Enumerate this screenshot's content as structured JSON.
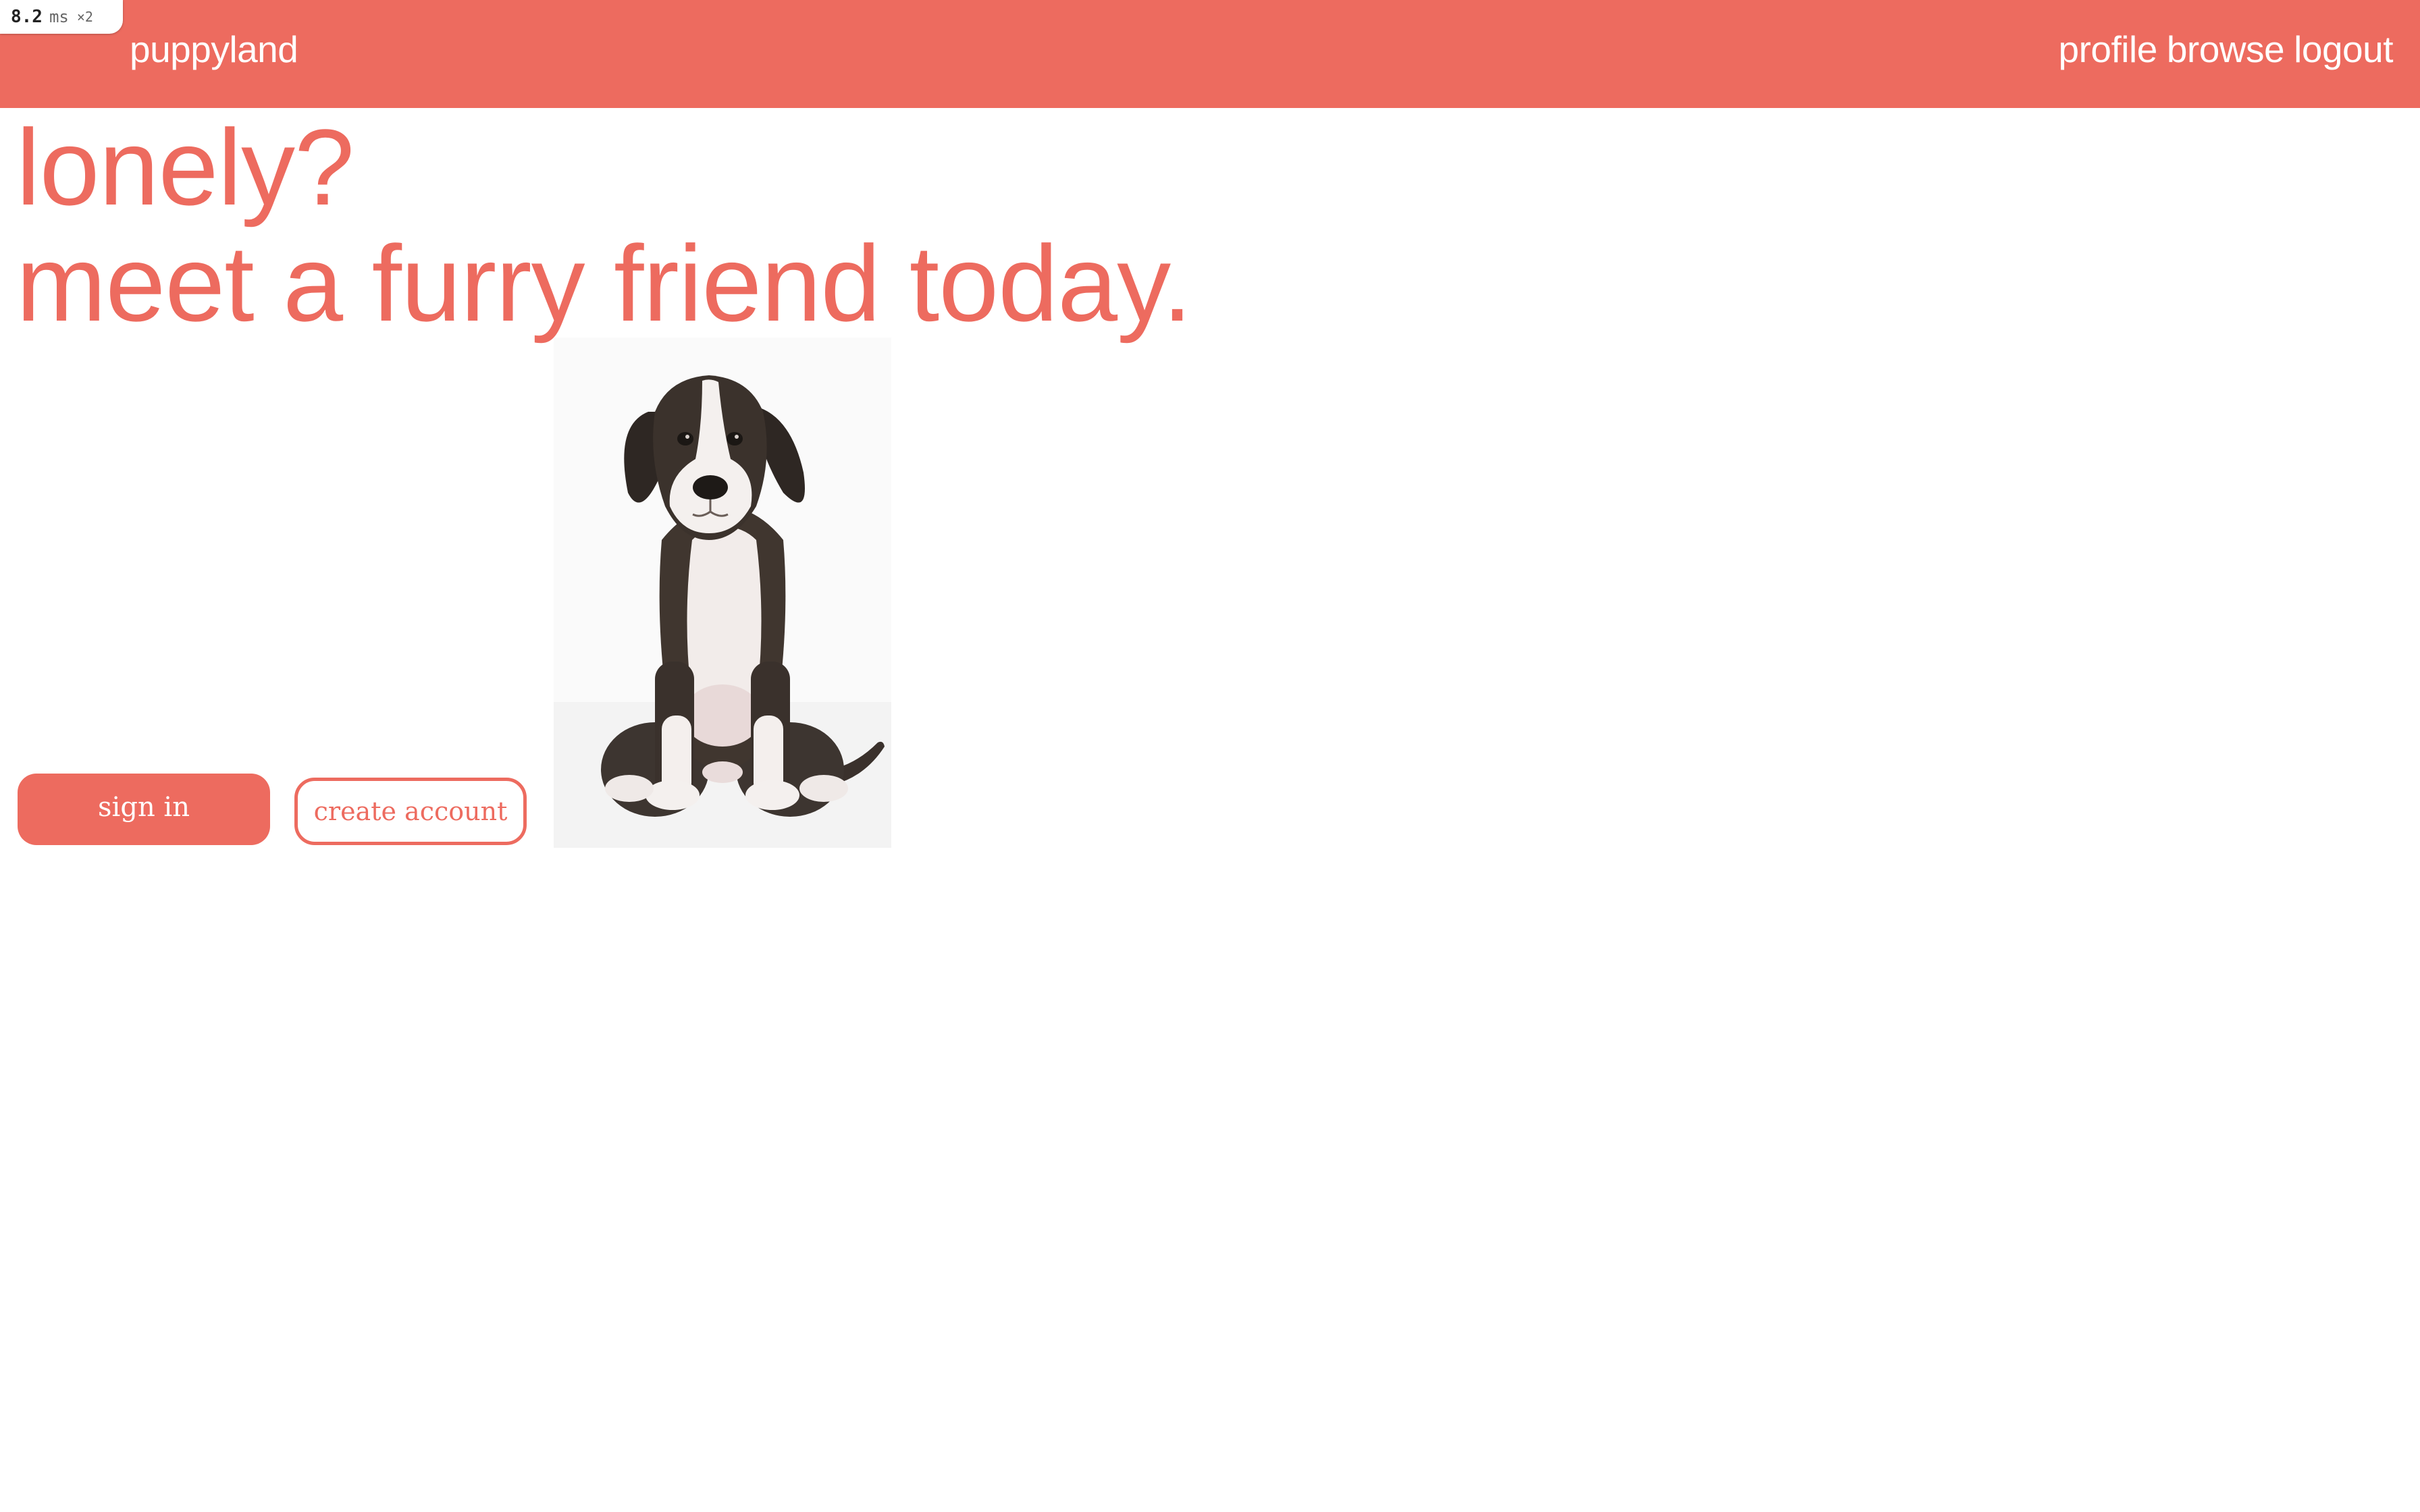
{
  "perf": {
    "value": "8.2",
    "unit": "ms",
    "multiplier": "×2"
  },
  "header": {
    "brand": "puppyland",
    "nav": {
      "profile": "profile",
      "browse": "browse",
      "logout": "logout"
    }
  },
  "hero": {
    "line1": "lonely?",
    "line2": "meet a furry friend today."
  },
  "actions": {
    "sign_in": "sign in",
    "create_account": "create account"
  },
  "colors": {
    "accent": "#ed6b5f",
    "background": "#ffffff",
    "on_accent": "#ffffff"
  },
  "icons": {
    "hero_image": "puppy-image"
  }
}
